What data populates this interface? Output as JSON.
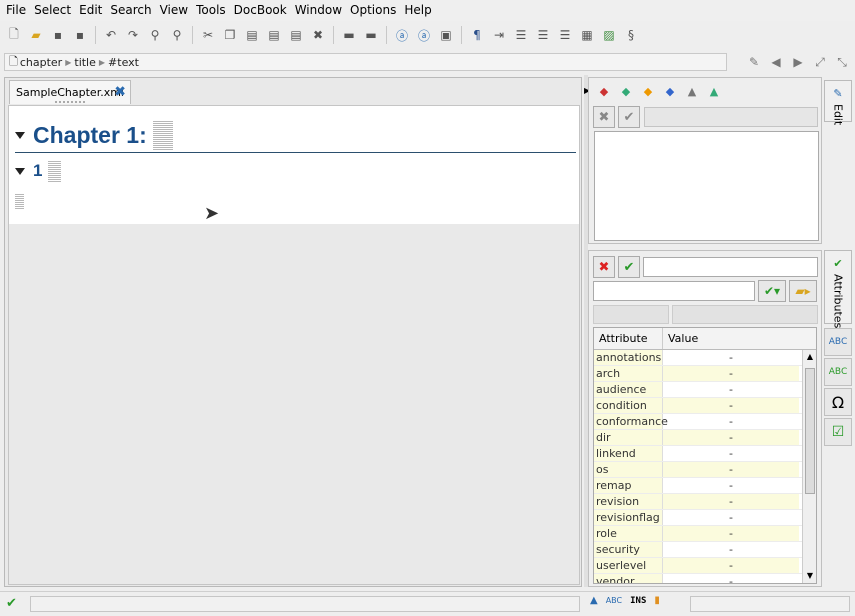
{
  "menu": [
    "File",
    "Select",
    "Edit",
    "Search",
    "View",
    "Tools",
    "DocBook",
    "Window",
    "Options",
    "Help"
  ],
  "toolbar": {
    "icons": [
      "new-file-icon",
      "open-folder-icon",
      "save-icon",
      "save-all-icon",
      "undo-icon",
      "redo-icon",
      "find-icon",
      "replace-icon",
      "cut-icon",
      "copy-icon",
      "paste-icon",
      "paste-special-icon",
      "paste-text-icon",
      "delete-icon",
      "split-icon",
      "join-icon",
      "emphasis-icon",
      "link-icon",
      "image-block-icon",
      "paragraph-icon",
      "indent-icon",
      "bulleted-list-icon",
      "numbered-list-icon",
      "variable-list-icon",
      "table-icon",
      "figure-icon",
      "section-icon"
    ]
  },
  "breadcrumb": {
    "items": [
      "chapter",
      "title",
      "#text"
    ]
  },
  "editor": {
    "tab_label": "SampleChapter.xml",
    "chapter_heading": "Chapter 1:",
    "section_number": "1"
  },
  "edit_panel": {
    "tab_label": "Edit"
  },
  "attributes_panel": {
    "tab_label": "Attributes",
    "columns": [
      "Attribute",
      "Value"
    ],
    "rows": [
      {
        "name": "annotations",
        "value": "-"
      },
      {
        "name": "arch",
        "value": "-"
      },
      {
        "name": "audience",
        "value": "-"
      },
      {
        "name": "condition",
        "value": "-"
      },
      {
        "name": "conformance",
        "value": "-"
      },
      {
        "name": "dir",
        "value": "-"
      },
      {
        "name": "linkend",
        "value": "-"
      },
      {
        "name": "os",
        "value": "-"
      },
      {
        "name": "remap",
        "value": "-"
      },
      {
        "name": "revision",
        "value": "-"
      },
      {
        "name": "revisionflag",
        "value": "-"
      },
      {
        "name": "role",
        "value": "-"
      },
      {
        "name": "security",
        "value": "-"
      },
      {
        "name": "userlevel",
        "value": "-"
      },
      {
        "name": "vendor",
        "value": "-"
      }
    ]
  },
  "statusbar": {
    "mode": "INS"
  },
  "colors": {
    "heading": "#1a4f8a",
    "row_highlight": "#fbfbdd",
    "ok_green": "#2a9a2a"
  }
}
